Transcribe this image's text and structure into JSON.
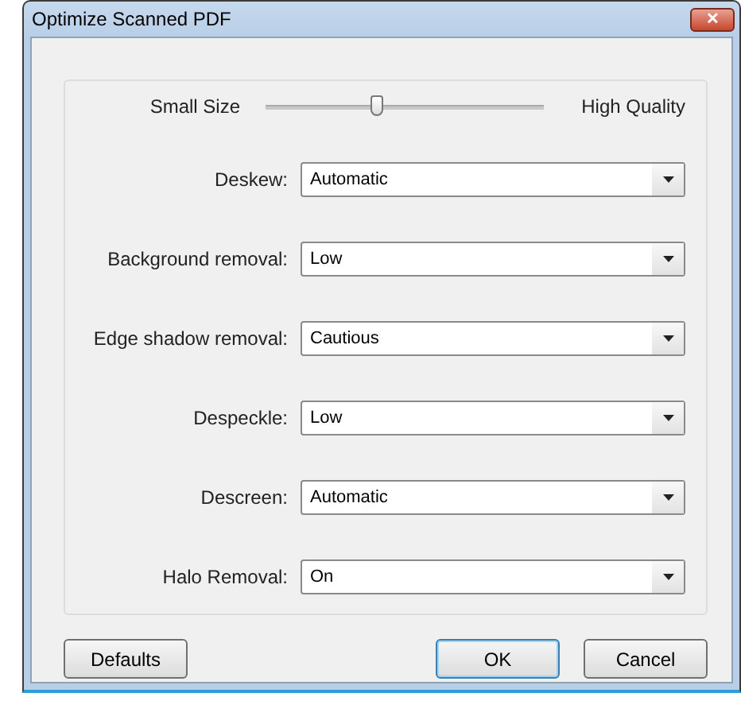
{
  "window": {
    "title": "Optimize Scanned PDF",
    "close": "✕"
  },
  "quality": {
    "min_label": "Small Size",
    "max_label": "High Quality",
    "level": 0.4
  },
  "options": [
    {
      "label": "Deskew:",
      "value": "Automatic"
    },
    {
      "label": "Background removal:",
      "value": "Low"
    },
    {
      "label": "Edge shadow removal:",
      "value": "Cautious"
    },
    {
      "label": "Despeckle:",
      "value": "Low"
    },
    {
      "label": "Descreen:",
      "value": "Automatic"
    },
    {
      "label": "Halo Removal:",
      "value": "On"
    }
  ],
  "buttons": [
    {
      "label": "Defaults",
      "focused": false
    },
    {
      "label": "OK",
      "focused": true
    },
    {
      "label": "Cancel",
      "focused": false
    }
  ]
}
